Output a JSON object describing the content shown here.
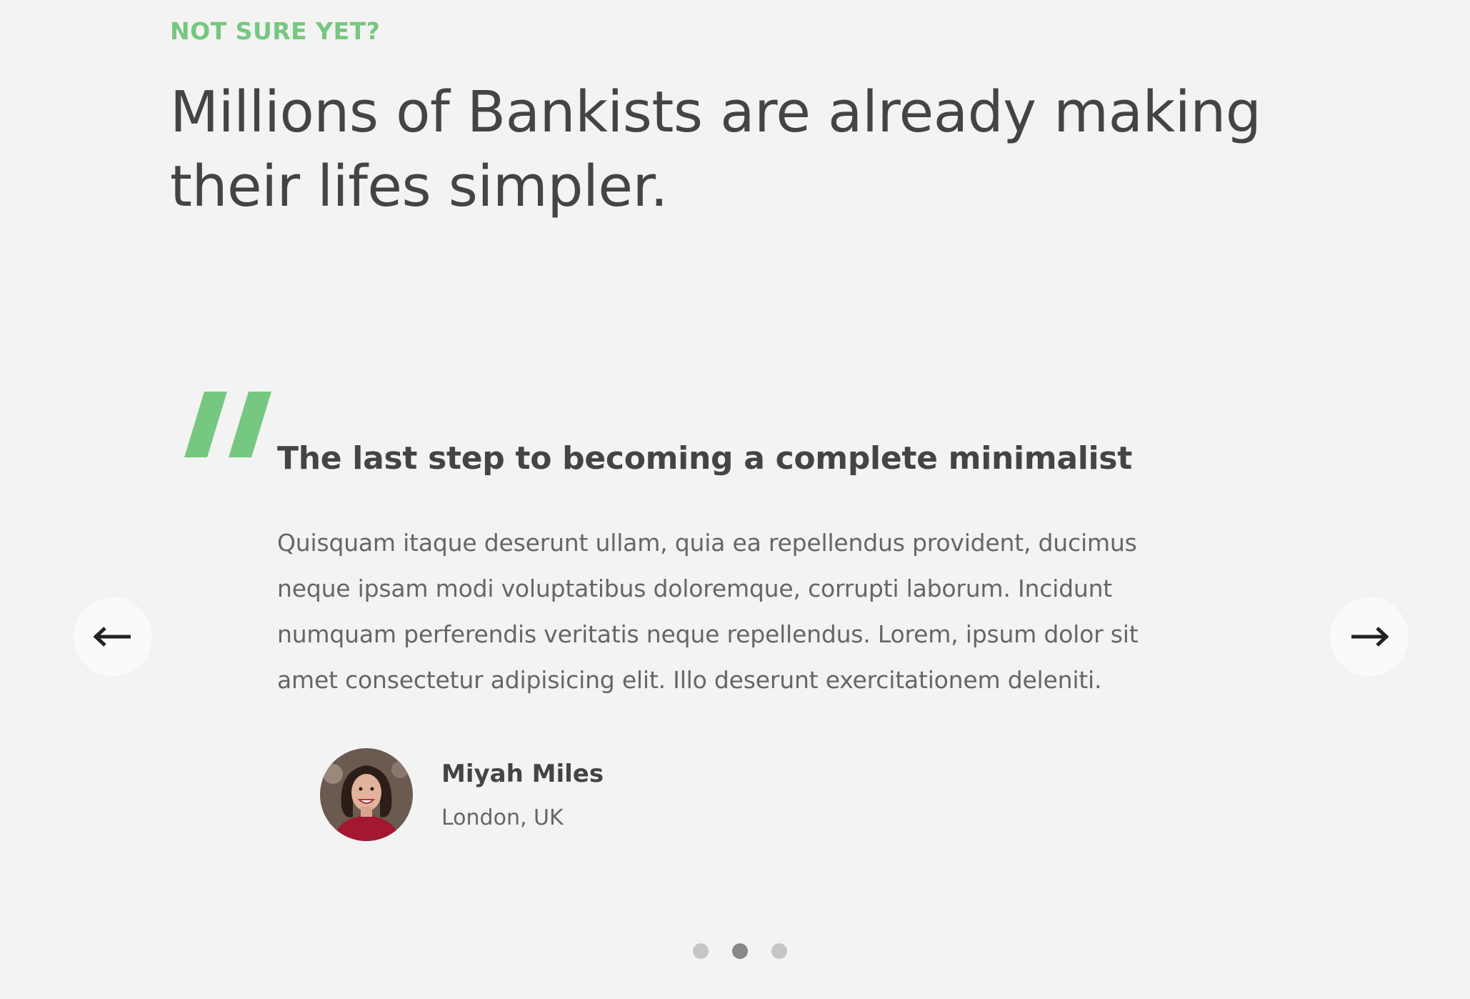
{
  "section": {
    "eyebrow": "NOT SURE YET?",
    "headline": "Millions of Bankists are already making their lifes simpler."
  },
  "testimonial": {
    "title": "The last step to becoming a complete minimalist",
    "text": "Quisquam itaque deserunt ullam, quia ea repellendus provident, ducimus neque ipsam modi voluptatibus doloremque, corrupti laborum. Incidunt numquam perferendis veritatis neque repellendus. Lorem, ipsum dolor sit amet consectetur adipisicing elit. Illo deserunt exercitationem deleniti.",
    "author": {
      "name": "Miyah Miles",
      "location": "London, UK"
    }
  },
  "slider": {
    "prev_icon": "arrow-left-icon",
    "next_icon": "arrow-right-icon",
    "dots_count": 3,
    "active_dot": 2
  },
  "colors": {
    "accent": "#76c77f",
    "background": "#f3f3f3",
    "heading": "#444444",
    "body_text": "#666666",
    "dot_inactive": "#c6c6c6",
    "dot_active": "#888888",
    "button_bg": "#fafafa"
  }
}
